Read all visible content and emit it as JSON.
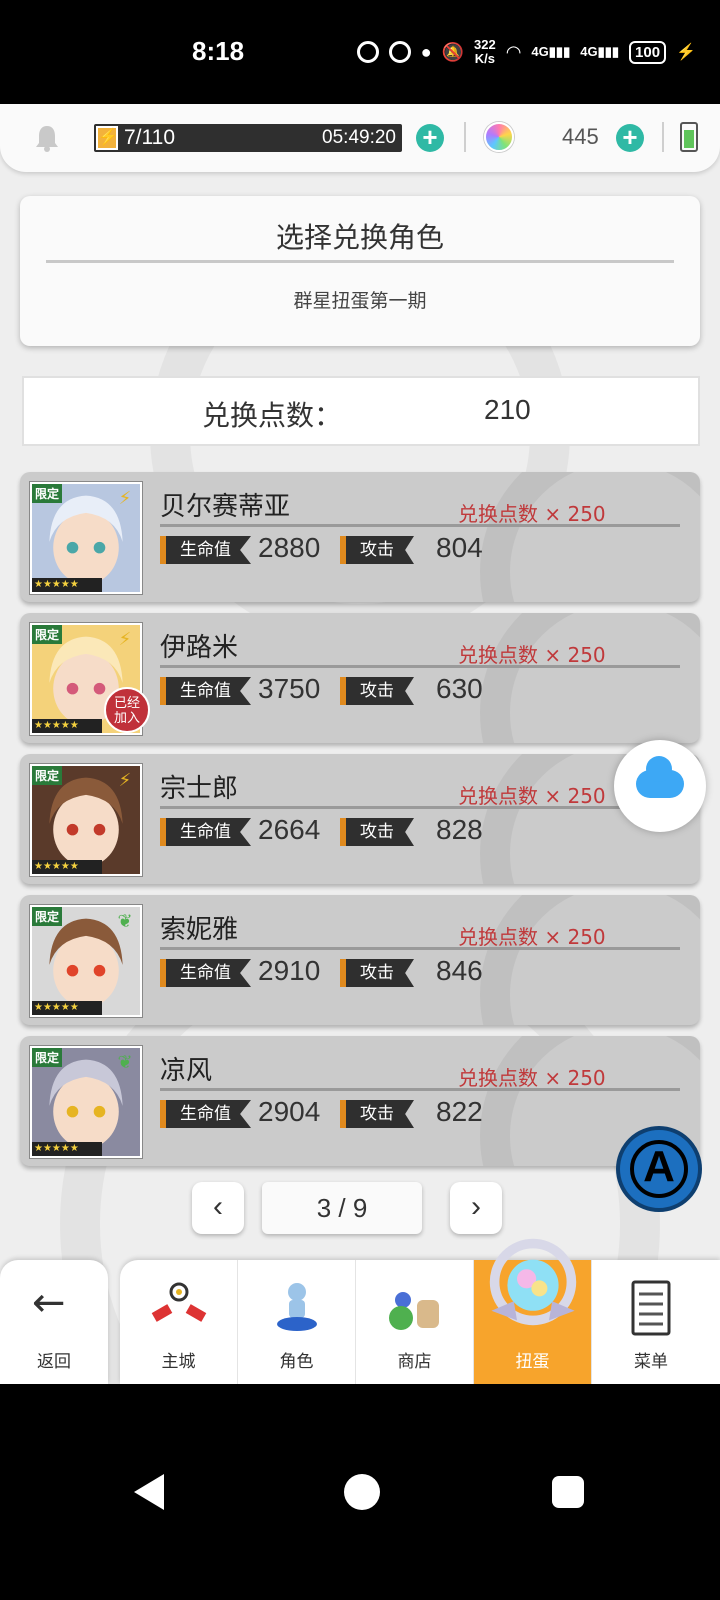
{
  "status_bar": {
    "time": "8:18",
    "speed_value": "322",
    "speed_unit": "K/s",
    "battery": "100",
    "icons": [
      "data-saver-icon",
      "speedometer-icon",
      "location-icon",
      "mute-icon",
      "wifi-icon",
      "signal-4g-icon",
      "signal-4g-icon",
      "battery-icon",
      "charging-icon"
    ]
  },
  "top_bar": {
    "energy": "7/110",
    "energy_timer": "05:49:20",
    "gems": "445"
  },
  "title_card": {
    "title": "选择兑换角色",
    "subtitle": "群星扭蛋第一期"
  },
  "points": {
    "label": "兑换点数：",
    "value": "210"
  },
  "stat_labels": {
    "hp": "生命值",
    "atk": "攻击"
  },
  "limited_tag": "限定",
  "joined_badge": "已经加入",
  "characters": [
    {
      "name": "贝尔赛蒂亚",
      "cost": "兑换点数 × 250",
      "hp": "2880",
      "atk": "804",
      "element": "lightning",
      "joined": false,
      "stars": 5
    },
    {
      "name": "伊路米",
      "cost": "兑换点数 × 250",
      "hp": "3750",
      "atk": "630",
      "element": "lightning",
      "joined": true,
      "stars": 5
    },
    {
      "name": "宗士郎",
      "cost": "兑换点数 × 250",
      "hp": "2664",
      "atk": "828",
      "element": "lightning",
      "joined": false,
      "stars": 5
    },
    {
      "name": "索妮雅",
      "cost": "兑换点数 × 250",
      "hp": "2910",
      "atk": "846",
      "element": "leaf",
      "joined": false,
      "stars": 5
    },
    {
      "name": "凉风",
      "cost": "兑换点数 × 250",
      "hp": "2904",
      "atk": "822",
      "element": "leaf",
      "joined": false,
      "stars": 5
    }
  ],
  "pager": {
    "label": "3 / 9",
    "prev": "‹",
    "next": "›"
  },
  "nav": {
    "back": "返回",
    "tabs": [
      {
        "label": "主城",
        "icon": "castle-icon"
      },
      {
        "label": "角色",
        "icon": "character-icon"
      },
      {
        "label": "商店",
        "icon": "shop-icon"
      },
      {
        "label": "扭蛋",
        "icon": "gacha-icon",
        "active": true
      },
      {
        "label": "菜单",
        "icon": "menu-icon"
      }
    ]
  },
  "colors": {
    "accent_teal": "#2fb9a5",
    "cost_red": "#c0393b",
    "active_tab": "#f7a42c",
    "stat_orange": "#e08a1e"
  }
}
